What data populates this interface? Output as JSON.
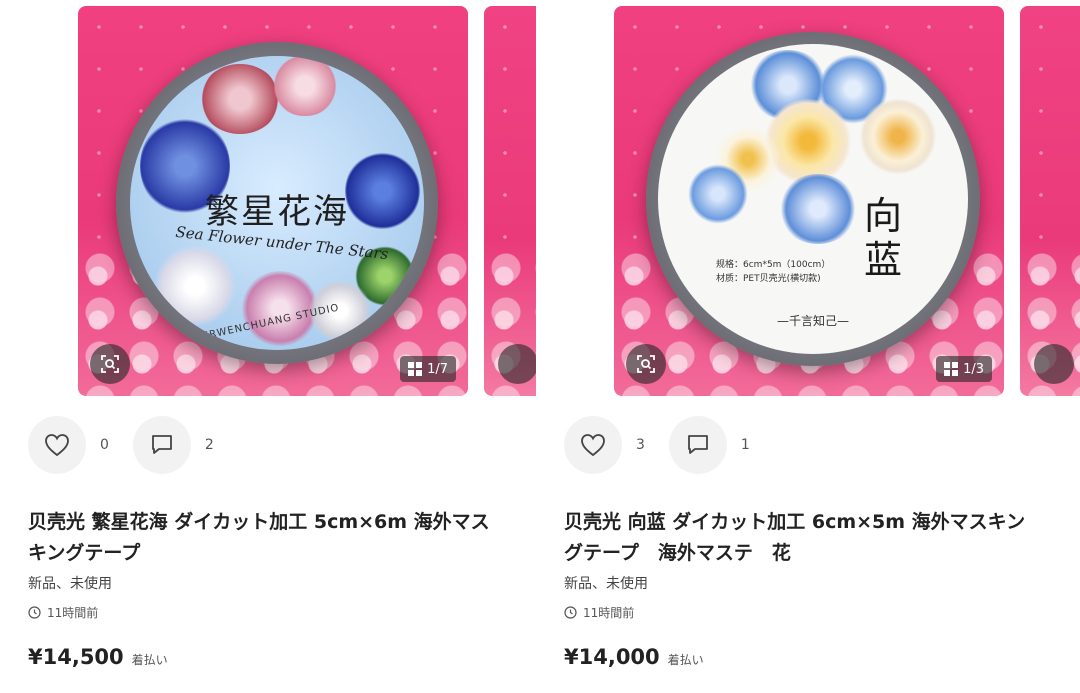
{
  "listings": [
    {
      "label_title": "繁星花海",
      "label_subtitle": "Sea Flower under The Stars",
      "label_brand": "YIERWENCHUANG STUDIO",
      "image_counter": "1/7",
      "likes": "0",
      "comments": "2",
      "title": "贝壳光 繁星花海 ダイカット加工 5cm×6m 海外マスキングテープ",
      "condition": "新品、未使用",
      "time": "11時間前",
      "price": "¥14,500",
      "shipping": "着払い"
    },
    {
      "label_title": "向蓝",
      "label_spec_line1": "规格：6cm*5m（100cm）",
      "label_spec_line2": "材质：PET贝壳光(横切款)",
      "label_brand": "—千言知己—",
      "image_counter": "1/3",
      "likes": "3",
      "comments": "1",
      "title": "贝壳光 向蓝 ダイカット加工 6cm×5m 海外マスキングテープ　海外マステ　花",
      "condition": "新品、未使用",
      "time": "11時間前",
      "price": "¥14,000",
      "shipping": "着払い"
    }
  ],
  "icons": {
    "scan": "scan-search-icon",
    "grid": "grid-icon",
    "heart": "heart-icon",
    "comment": "comment-icon",
    "clock": "clock-icon"
  },
  "colors": {
    "background_pink": "#ea3a7a",
    "button_gray": "#f2f2f2",
    "text": "#222222"
  }
}
